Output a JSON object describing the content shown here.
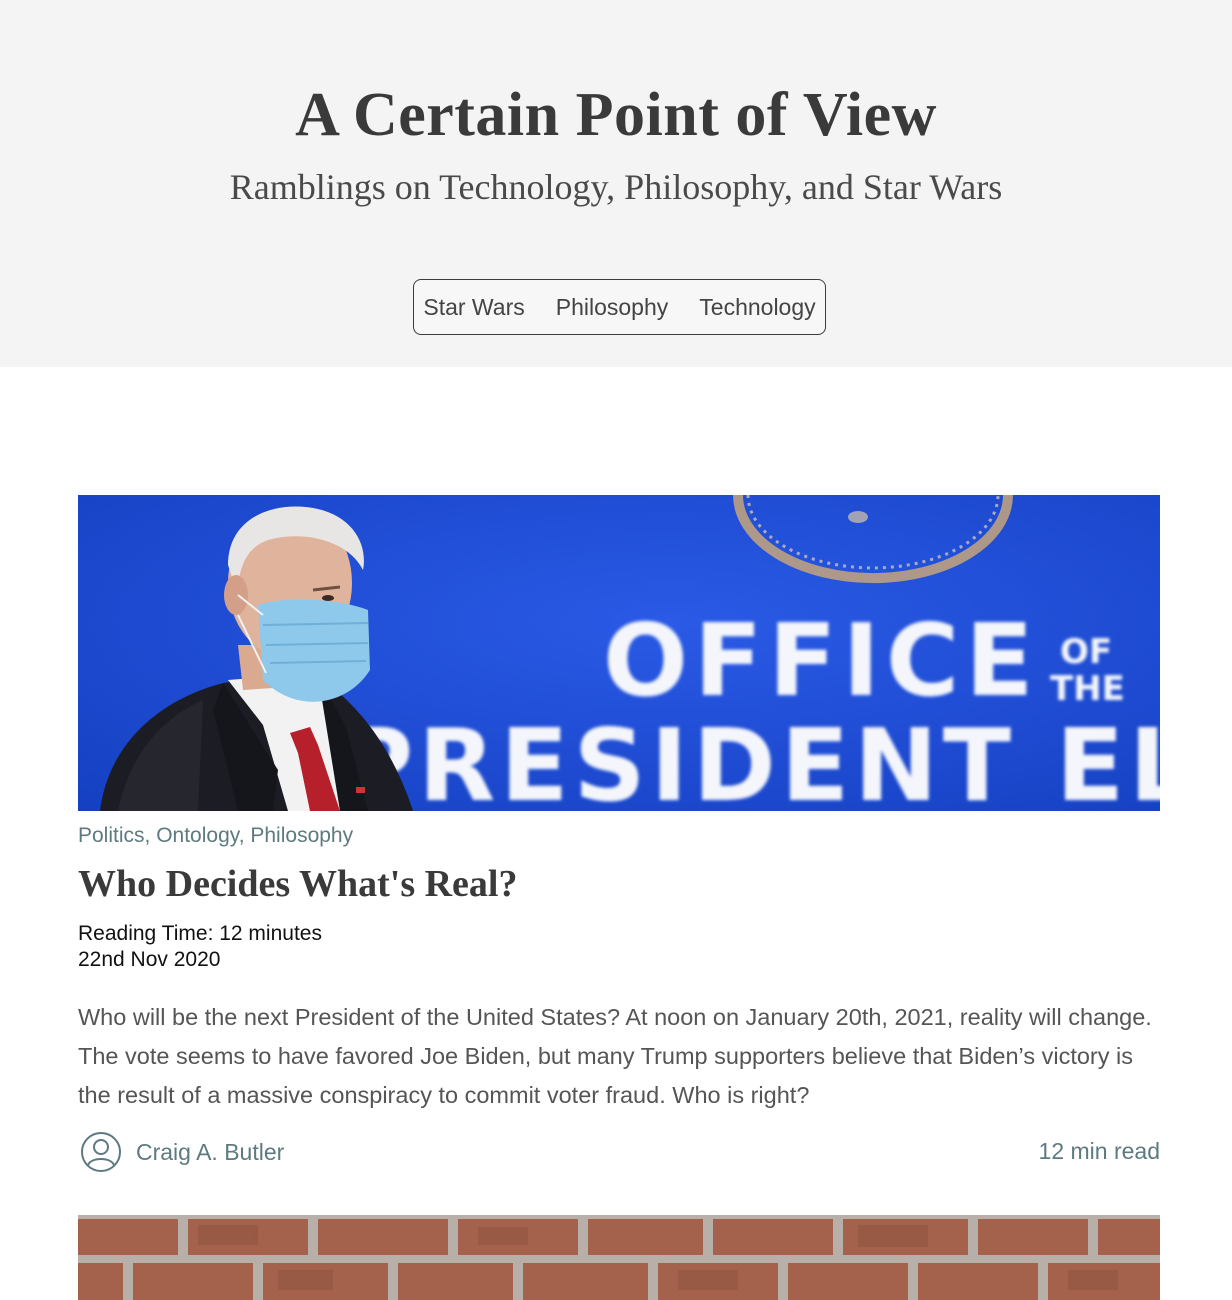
{
  "header": {
    "title": "A Certain Point of View",
    "subtitle": "Ramblings on Technology, Philosophy, and Star Wars",
    "nav": [
      "Star Wars",
      "Philosophy",
      "Technology"
    ]
  },
  "post": {
    "image_text": {
      "line1": "OFFICE",
      "of": "OF",
      "the": "THE",
      "line2": "PRESIDENT EL"
    },
    "categories": [
      "Politics",
      "Ontology",
      "Philosophy"
    ],
    "category_separator": ", ",
    "title": "Who Decides What's Real?",
    "reading_time": "Reading Time: 12 minutes",
    "date": "22nd Nov 2020",
    "excerpt": "Who will be the next President of the United States? At noon on January 20th, 2021, reality will change. The vote seems to have favored Joe Biden, but many Trump supporters believe that Biden’s victory is the result of a massive conspiracy to commit voter fraud. Who is right?",
    "author": "Craig A. Butler",
    "read_time_short": "12 min read"
  },
  "colors": {
    "header_bg": "#f4f4f4",
    "accent_muted": "#5d7a80",
    "image_blue": "#1d4fd9"
  }
}
